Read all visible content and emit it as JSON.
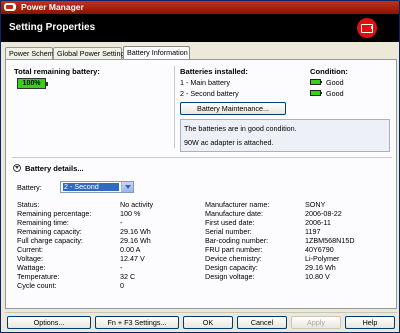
{
  "window": {
    "title": "Power Manager"
  },
  "header": {
    "title": "Setting Properties"
  },
  "tabs": [
    {
      "label": "Power Scheme",
      "active": false
    },
    {
      "label": "Global Power Settings",
      "active": false
    },
    {
      "label": "Battery Information",
      "active": true
    }
  ],
  "summary": {
    "total_label": "Total remaining battery:",
    "total_value": "100%",
    "installed_label": "Batteries installed:",
    "condition_label": "Condition:",
    "batteries": [
      {
        "name": "1 - Main battery",
        "condition": "Good"
      },
      {
        "name": "2 - Second battery",
        "condition": "Good"
      }
    ],
    "maintenance_button": "Battery Maintenance...",
    "messages": [
      "The batteries are in good condition.",
      "90W ac adapter is attached."
    ]
  },
  "details": {
    "heading": "Battery details...",
    "battery_label": "Battery:",
    "battery_selected": "2 - Second",
    "left": [
      {
        "label": "Status:",
        "value": "No activity"
      },
      {
        "label": "Remaining percentage:",
        "value": "100 %"
      },
      {
        "label": "Remaining time:",
        "value": "-"
      },
      {
        "label": "Remaining capacity:",
        "value": "29.16 Wh"
      },
      {
        "label": "Full charge capacity:",
        "value": "29.16 Wh"
      },
      {
        "label": "Current:",
        "value": "0.00 A"
      },
      {
        "label": "Voltage:",
        "value": "12.47 V"
      },
      {
        "label": "Wattage:",
        "value": "-"
      },
      {
        "label": "Temperature:",
        "value": "32 C"
      },
      {
        "label": "Cycle count:",
        "value": "0"
      }
    ],
    "right": [
      {
        "label": "Manufacturer name:",
        "value": "SONY"
      },
      {
        "label": "Manufacture date:",
        "value": "2006-08-22"
      },
      {
        "label": "First used date:",
        "value": "2006-11"
      },
      {
        "label": "Serial number:",
        "value": "1197"
      },
      {
        "label": "Bar-coding number:",
        "value": "1ZBM568N15D"
      },
      {
        "label": "FRU part number:",
        "value": "40Y6790"
      },
      {
        "label": "Device chemistry:",
        "value": "Li-Polymer"
      },
      {
        "label": "Design capacity:",
        "value": "29.16 Wh"
      },
      {
        "label": "Design voltage:",
        "value": "10.80 V"
      }
    ]
  },
  "footer": {
    "options": "Options...",
    "fn_f3": "Fn + F3 Settings...",
    "ok": "OK",
    "cancel": "Cancel",
    "apply": "Apply",
    "help": "Help"
  },
  "colors": {
    "titlebar": "#b02010",
    "header_bg": "#000000",
    "battery_green": "#3ad01a",
    "selection_blue": "#316ac5"
  },
  "icons": [
    "app-icon",
    "power-manager-logo-icon",
    "battery-full-icon",
    "battery-good-icon",
    "collapse-icon",
    "dropdown-arrow-icon"
  ]
}
